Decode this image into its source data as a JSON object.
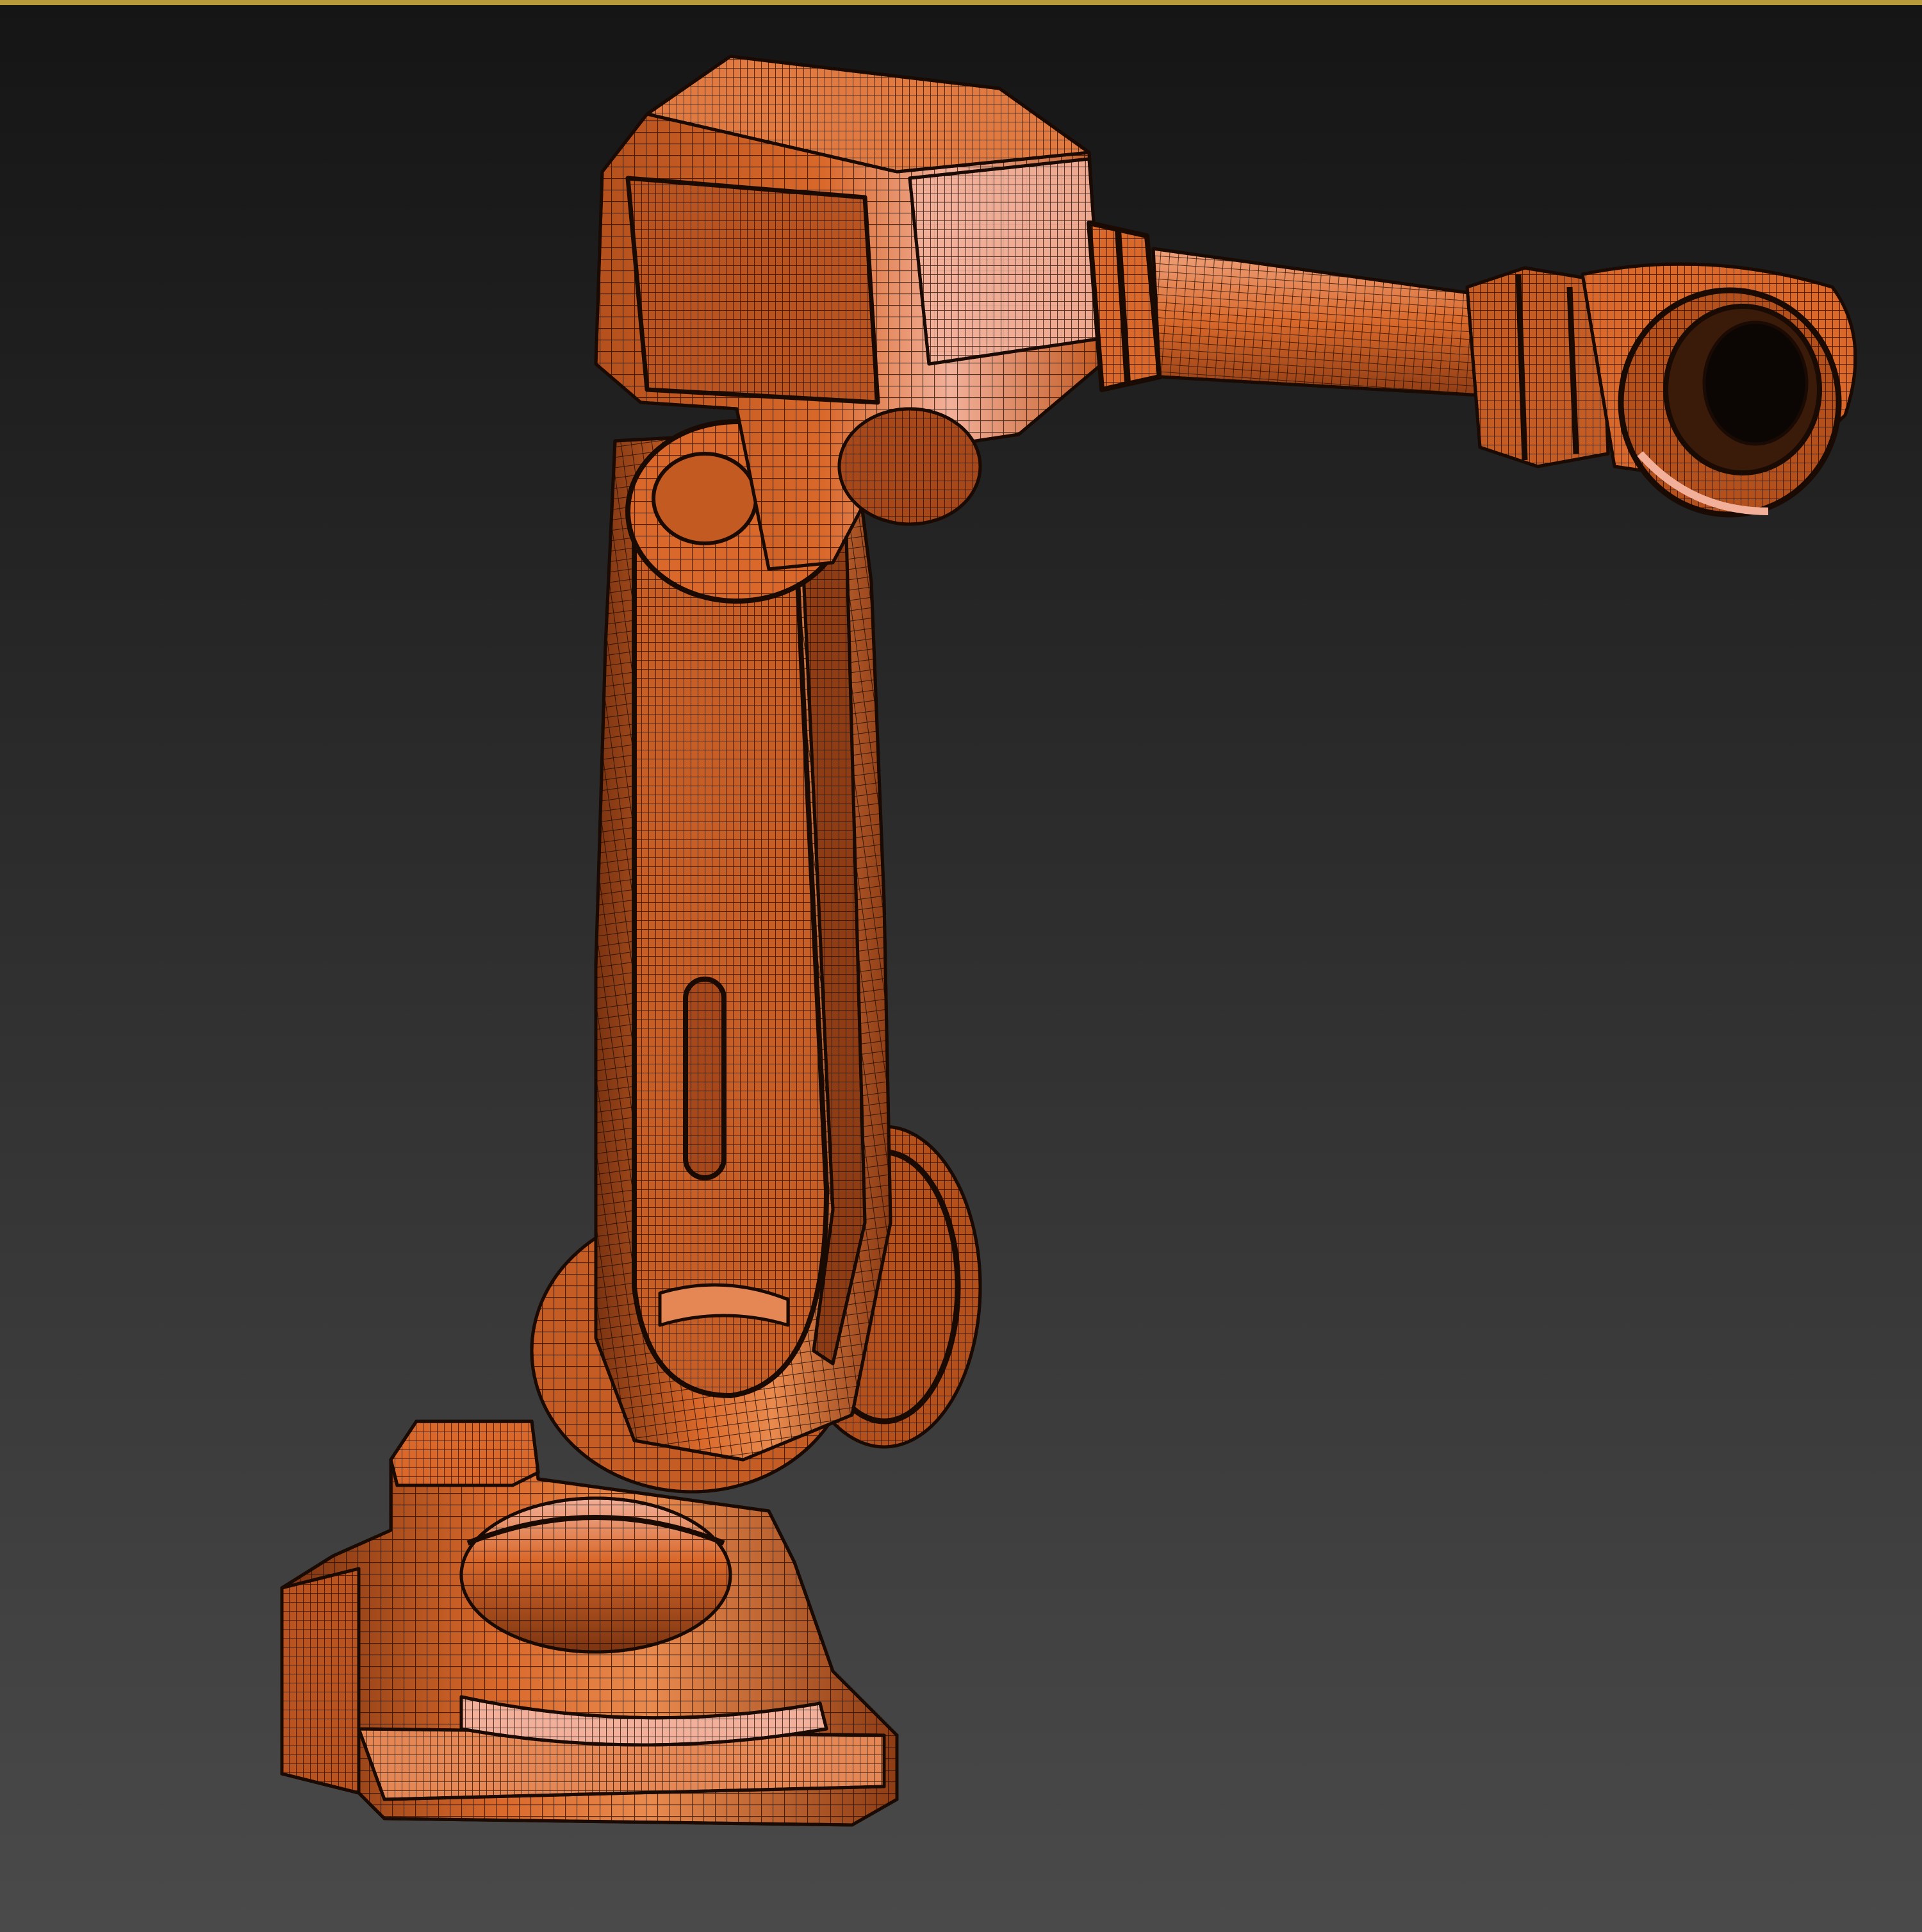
{
  "viewport": {
    "background_top": "#151515",
    "background_bottom": "#4a4a4a",
    "active_border_color": "#b89a3a"
  },
  "model": {
    "icon": "robot-arm-icon",
    "shading": "wireframe-over-shaded",
    "surface_color": "#d9682a",
    "highlight_color": "#f2b09a",
    "shadow_color": "#7a3310",
    "wire_color": "#1a0a04"
  }
}
